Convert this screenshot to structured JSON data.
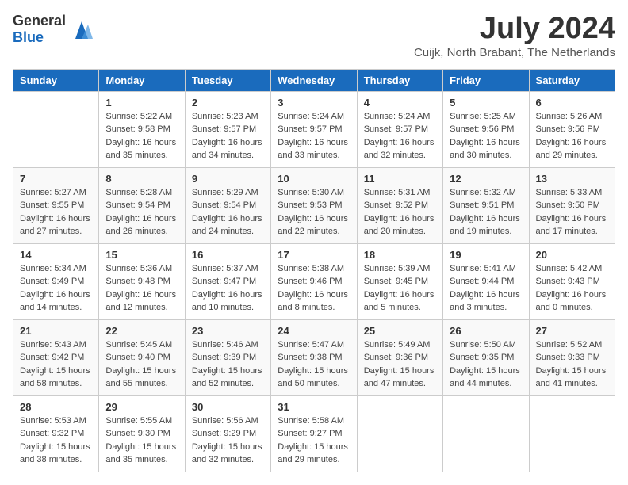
{
  "logo": {
    "general": "General",
    "blue": "Blue"
  },
  "title": {
    "month_year": "July 2024",
    "location": "Cuijk, North Brabant, The Netherlands"
  },
  "weekdays": [
    "Sunday",
    "Monday",
    "Tuesday",
    "Wednesday",
    "Thursday",
    "Friday",
    "Saturday"
  ],
  "weeks": [
    [
      {
        "day": "",
        "details": ""
      },
      {
        "day": "1",
        "details": "Sunrise: 5:22 AM\nSunset: 9:58 PM\nDaylight: 16 hours\nand 35 minutes."
      },
      {
        "day": "2",
        "details": "Sunrise: 5:23 AM\nSunset: 9:57 PM\nDaylight: 16 hours\nand 34 minutes."
      },
      {
        "day": "3",
        "details": "Sunrise: 5:24 AM\nSunset: 9:57 PM\nDaylight: 16 hours\nand 33 minutes."
      },
      {
        "day": "4",
        "details": "Sunrise: 5:24 AM\nSunset: 9:57 PM\nDaylight: 16 hours\nand 32 minutes."
      },
      {
        "day": "5",
        "details": "Sunrise: 5:25 AM\nSunset: 9:56 PM\nDaylight: 16 hours\nand 30 minutes."
      },
      {
        "day": "6",
        "details": "Sunrise: 5:26 AM\nSunset: 9:56 PM\nDaylight: 16 hours\nand 29 minutes."
      }
    ],
    [
      {
        "day": "7",
        "details": "Sunrise: 5:27 AM\nSunset: 9:55 PM\nDaylight: 16 hours\nand 27 minutes."
      },
      {
        "day": "8",
        "details": "Sunrise: 5:28 AM\nSunset: 9:54 PM\nDaylight: 16 hours\nand 26 minutes."
      },
      {
        "day": "9",
        "details": "Sunrise: 5:29 AM\nSunset: 9:54 PM\nDaylight: 16 hours\nand 24 minutes."
      },
      {
        "day": "10",
        "details": "Sunrise: 5:30 AM\nSunset: 9:53 PM\nDaylight: 16 hours\nand 22 minutes."
      },
      {
        "day": "11",
        "details": "Sunrise: 5:31 AM\nSunset: 9:52 PM\nDaylight: 16 hours\nand 20 minutes."
      },
      {
        "day": "12",
        "details": "Sunrise: 5:32 AM\nSunset: 9:51 PM\nDaylight: 16 hours\nand 19 minutes."
      },
      {
        "day": "13",
        "details": "Sunrise: 5:33 AM\nSunset: 9:50 PM\nDaylight: 16 hours\nand 17 minutes."
      }
    ],
    [
      {
        "day": "14",
        "details": "Sunrise: 5:34 AM\nSunset: 9:49 PM\nDaylight: 16 hours\nand 14 minutes."
      },
      {
        "day": "15",
        "details": "Sunrise: 5:36 AM\nSunset: 9:48 PM\nDaylight: 16 hours\nand 12 minutes."
      },
      {
        "day": "16",
        "details": "Sunrise: 5:37 AM\nSunset: 9:47 PM\nDaylight: 16 hours\nand 10 minutes."
      },
      {
        "day": "17",
        "details": "Sunrise: 5:38 AM\nSunset: 9:46 PM\nDaylight: 16 hours\nand 8 minutes."
      },
      {
        "day": "18",
        "details": "Sunrise: 5:39 AM\nSunset: 9:45 PM\nDaylight: 16 hours\nand 5 minutes."
      },
      {
        "day": "19",
        "details": "Sunrise: 5:41 AM\nSunset: 9:44 PM\nDaylight: 16 hours\nand 3 minutes."
      },
      {
        "day": "20",
        "details": "Sunrise: 5:42 AM\nSunset: 9:43 PM\nDaylight: 16 hours\nand 0 minutes."
      }
    ],
    [
      {
        "day": "21",
        "details": "Sunrise: 5:43 AM\nSunset: 9:42 PM\nDaylight: 15 hours\nand 58 minutes."
      },
      {
        "day": "22",
        "details": "Sunrise: 5:45 AM\nSunset: 9:40 PM\nDaylight: 15 hours\nand 55 minutes."
      },
      {
        "day": "23",
        "details": "Sunrise: 5:46 AM\nSunset: 9:39 PM\nDaylight: 15 hours\nand 52 minutes."
      },
      {
        "day": "24",
        "details": "Sunrise: 5:47 AM\nSunset: 9:38 PM\nDaylight: 15 hours\nand 50 minutes."
      },
      {
        "day": "25",
        "details": "Sunrise: 5:49 AM\nSunset: 9:36 PM\nDaylight: 15 hours\nand 47 minutes."
      },
      {
        "day": "26",
        "details": "Sunrise: 5:50 AM\nSunset: 9:35 PM\nDaylight: 15 hours\nand 44 minutes."
      },
      {
        "day": "27",
        "details": "Sunrise: 5:52 AM\nSunset: 9:33 PM\nDaylight: 15 hours\nand 41 minutes."
      }
    ],
    [
      {
        "day": "28",
        "details": "Sunrise: 5:53 AM\nSunset: 9:32 PM\nDaylight: 15 hours\nand 38 minutes."
      },
      {
        "day": "29",
        "details": "Sunrise: 5:55 AM\nSunset: 9:30 PM\nDaylight: 15 hours\nand 35 minutes."
      },
      {
        "day": "30",
        "details": "Sunrise: 5:56 AM\nSunset: 9:29 PM\nDaylight: 15 hours\nand 32 minutes."
      },
      {
        "day": "31",
        "details": "Sunrise: 5:58 AM\nSunset: 9:27 PM\nDaylight: 15 hours\nand 29 minutes."
      },
      {
        "day": "",
        "details": ""
      },
      {
        "day": "",
        "details": ""
      },
      {
        "day": "",
        "details": ""
      }
    ]
  ]
}
